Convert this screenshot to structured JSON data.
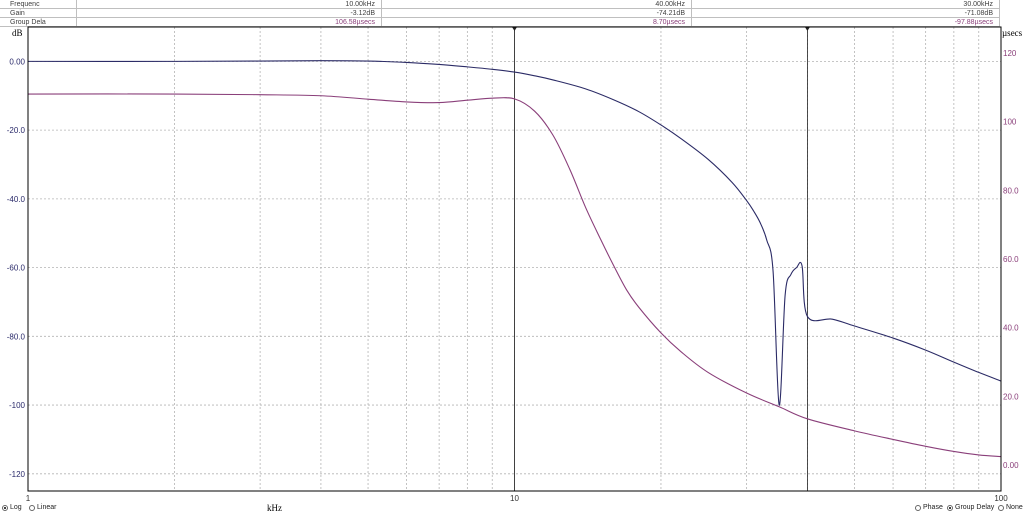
{
  "readout": {
    "rows": [
      {
        "label": "Frequenc",
        "values": [
          "10.00kHz",
          "40.00kHz",
          "30.00kHz"
        ]
      },
      {
        "label": "Gain",
        "values": [
          "-3.12dB",
          "-74.21dB",
          "-71.08dB"
        ]
      },
      {
        "label": "Group Dela",
        "values": [
          "106.58µsecs",
          "8.70µsecs",
          "-97.88µsecs"
        ]
      }
    ]
  },
  "colors": {
    "gain": "#2b2b66",
    "group_delay": "#8a3f7a",
    "grid": "#b4b4b4",
    "cursor": "#222222",
    "axis": "#000000"
  },
  "chart_data": {
    "type": "line",
    "xscale": "log",
    "xlim": [
      1,
      100
    ],
    "xlabel": "kHz",
    "x_ticks": [
      "1",
      "10",
      "100"
    ],
    "ylabel": "dB",
    "ylim": [
      -125,
      10
    ],
    "y_ticks": [
      "0.00",
      "-20.0",
      "-40.0",
      "-60.0",
      "-80.0",
      "-100",
      "-120"
    ],
    "y2label": "µsecs",
    "y2lim": [
      -7.5,
      127.5
    ],
    "y2_ticks": [
      "120",
      "100",
      "80.0",
      "60.0",
      "40.0",
      "20.0",
      "0.00"
    ],
    "cursors": [
      10,
      40
    ],
    "grid": true,
    "series": [
      {
        "axis": "left",
        "x": [
          1,
          2,
          3,
          4,
          5,
          6,
          7,
          8,
          9,
          10,
          11,
          12,
          14,
          16,
          18,
          20,
          22,
          25,
          28,
          30,
          31,
          32,
          33,
          34,
          35,
          36,
          37,
          38,
          39,
          40,
          45,
          50,
          60,
          70,
          80,
          90,
          100
        ],
        "values": [
          0,
          0,
          0.1,
          0.2,
          0.1,
          -0.3,
          -0.9,
          -1.6,
          -2.3,
          -3.12,
          -4.2,
          -5.4,
          -8,
          -11.2,
          -14.6,
          -18.5,
          -22.5,
          -28.5,
          -35.2,
          -40.5,
          -43.5,
          -47,
          -52,
          -61,
          -100,
          -68,
          -62,
          -60,
          -59.5,
          -74.21,
          -75,
          -77,
          -80.5,
          -84,
          -87.5,
          -90.5,
          -93
        ]
      },
      {
        "axis": "right",
        "x": [
          1,
          2,
          3,
          4,
          5,
          6,
          7,
          8,
          9,
          10,
          11,
          12,
          13,
          14,
          15,
          16,
          17,
          18,
          20,
          22,
          25,
          30,
          35,
          40,
          50,
          60,
          70,
          80,
          90,
          100
        ],
        "values": [
          108,
          108,
          107.8,
          107.5,
          106.5,
          105.7,
          105.5,
          106.2,
          106.8,
          106.58,
          103,
          96,
          86,
          75,
          66,
          58,
          51,
          46,
          38.5,
          33,
          27,
          21,
          17,
          13.5,
          10,
          7.5,
          5.5,
          4,
          3,
          2.5
        ]
      }
    ]
  },
  "bottom": {
    "left_options": [
      "Log",
      "Linear"
    ],
    "left_selected": "Log",
    "right_options": [
      "Phase",
      "Group Delay",
      "None"
    ],
    "right_selected": "Group Delay"
  }
}
